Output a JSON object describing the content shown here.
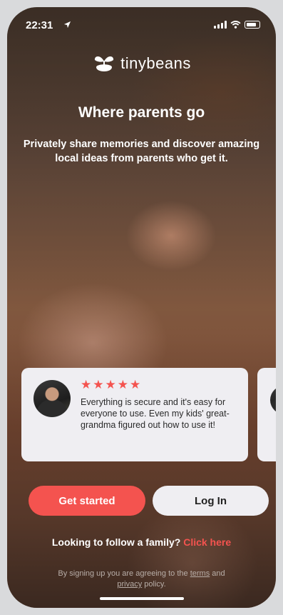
{
  "status_bar": {
    "time": "22:31"
  },
  "brand": {
    "name": "tinybeans",
    "accent": "#f4534f"
  },
  "headline": "Where parents go",
  "subtitle": "Privately share memories and discover amazing local ideas from parents who get it.",
  "reviews": [
    {
      "stars": "★★★★★",
      "rating": 5,
      "text": "Everything is secure and it's easy for everyone to use. Even my kids' great-grandma figured out how to use it!"
    }
  ],
  "actions": {
    "get_started": "Get started",
    "log_in": "Log In"
  },
  "follow": {
    "prompt": "Looking to follow a family?",
    "link": "Click here"
  },
  "legal": {
    "prefix": "By signing up you are agreeing to the",
    "terms": "terms",
    "and": "and",
    "privacy": "privacy",
    "suffix": "policy."
  }
}
